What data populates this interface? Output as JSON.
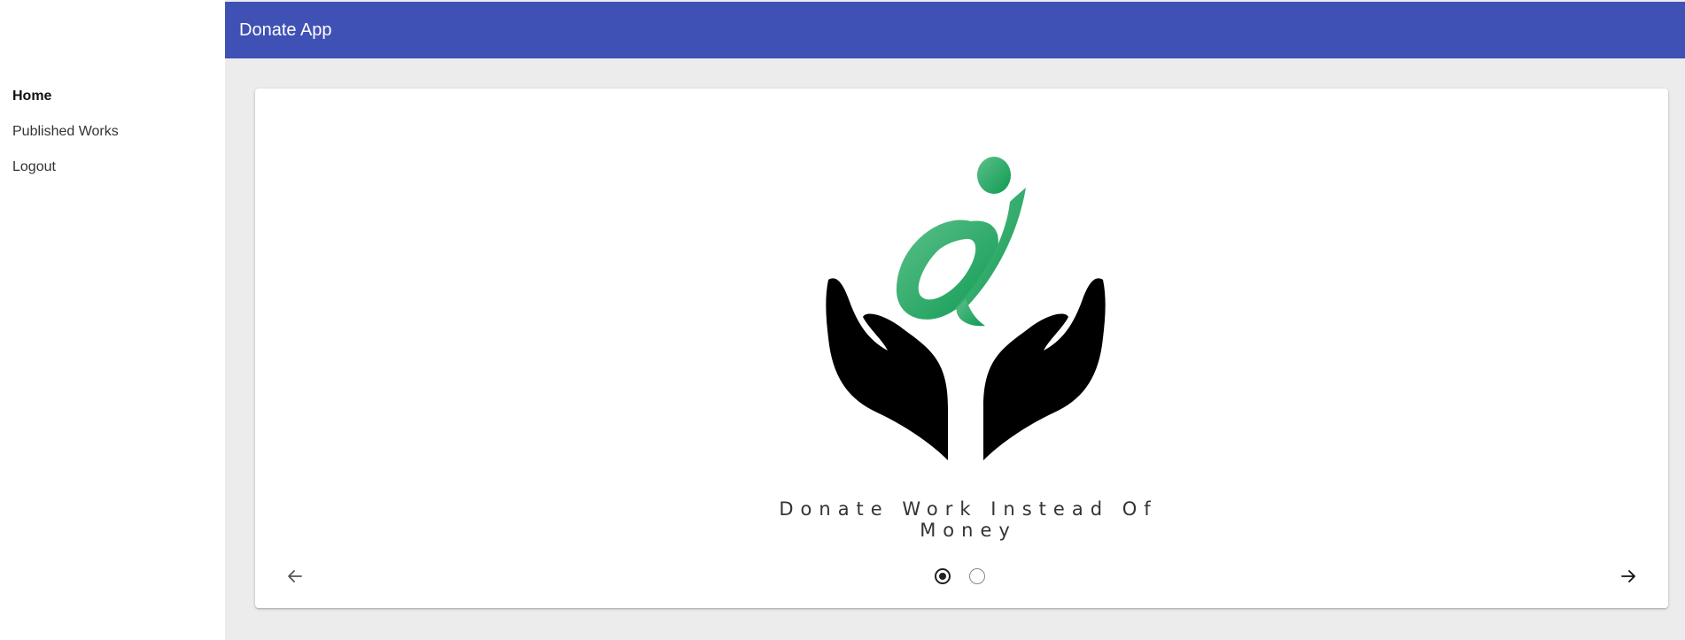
{
  "app": {
    "title": "Donate App",
    "accent": "#3f51b5"
  },
  "sidebar": {
    "items": [
      {
        "label": "Home",
        "active": true
      },
      {
        "label": "Published Works",
        "active": false
      },
      {
        "label": "Logout",
        "active": false
      }
    ]
  },
  "carousel": {
    "slide": {
      "logo_icon": "hands-holding-person-logo",
      "tagline": "Donate Work Instead Of Money"
    },
    "prev_icon": "arrow-left-icon",
    "next_icon": "arrow-right-icon",
    "total_slides": 2,
    "active_slide": 1,
    "colors": {
      "logo_green": "#1aa05a",
      "logo_black": "#000000"
    }
  }
}
